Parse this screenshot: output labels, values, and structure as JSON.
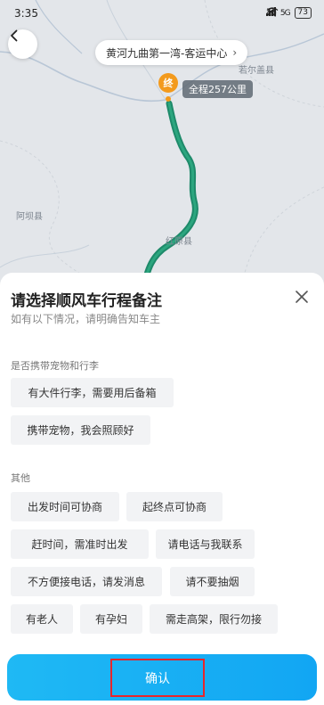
{
  "status_bar": {
    "time": "3:35",
    "signal_1": "4G",
    "signal_2": "5G",
    "battery": "73"
  },
  "map": {
    "destination": "黄河九曲第一湾-客运中心",
    "end_marker": "终",
    "total_distance": "全程257公里",
    "labels": {
      "ruoergai": "若尔盖县",
      "aba": "阿坝县",
      "hongyuan": "红原县"
    }
  },
  "sheet": {
    "title": "请选择顺风车行程备注",
    "subtitle": "如有以下情况，请明确告知车主",
    "section_luggage": {
      "label": "是否携带宠物和行李",
      "options": [
        "有大件行李，需要用后备箱",
        "携带宠物，我会照顾好"
      ]
    },
    "section_other": {
      "label": "其他",
      "options": [
        "出发时间可协商",
        "起终点可协商",
        "赶时间，需准时出发",
        "请电话与我联系",
        "不方便接电话，请发消息",
        "请不要抽烟",
        "有老人",
        "有孕妇",
        "需走高架，限行勿接"
      ]
    },
    "confirm_label": "确认"
  },
  "colors": {
    "route": "#1e8a6a",
    "end_marker": "#f39a1c",
    "confirm_gradient_start": "#1fb9f4",
    "highlight_border": "#e8262b"
  }
}
